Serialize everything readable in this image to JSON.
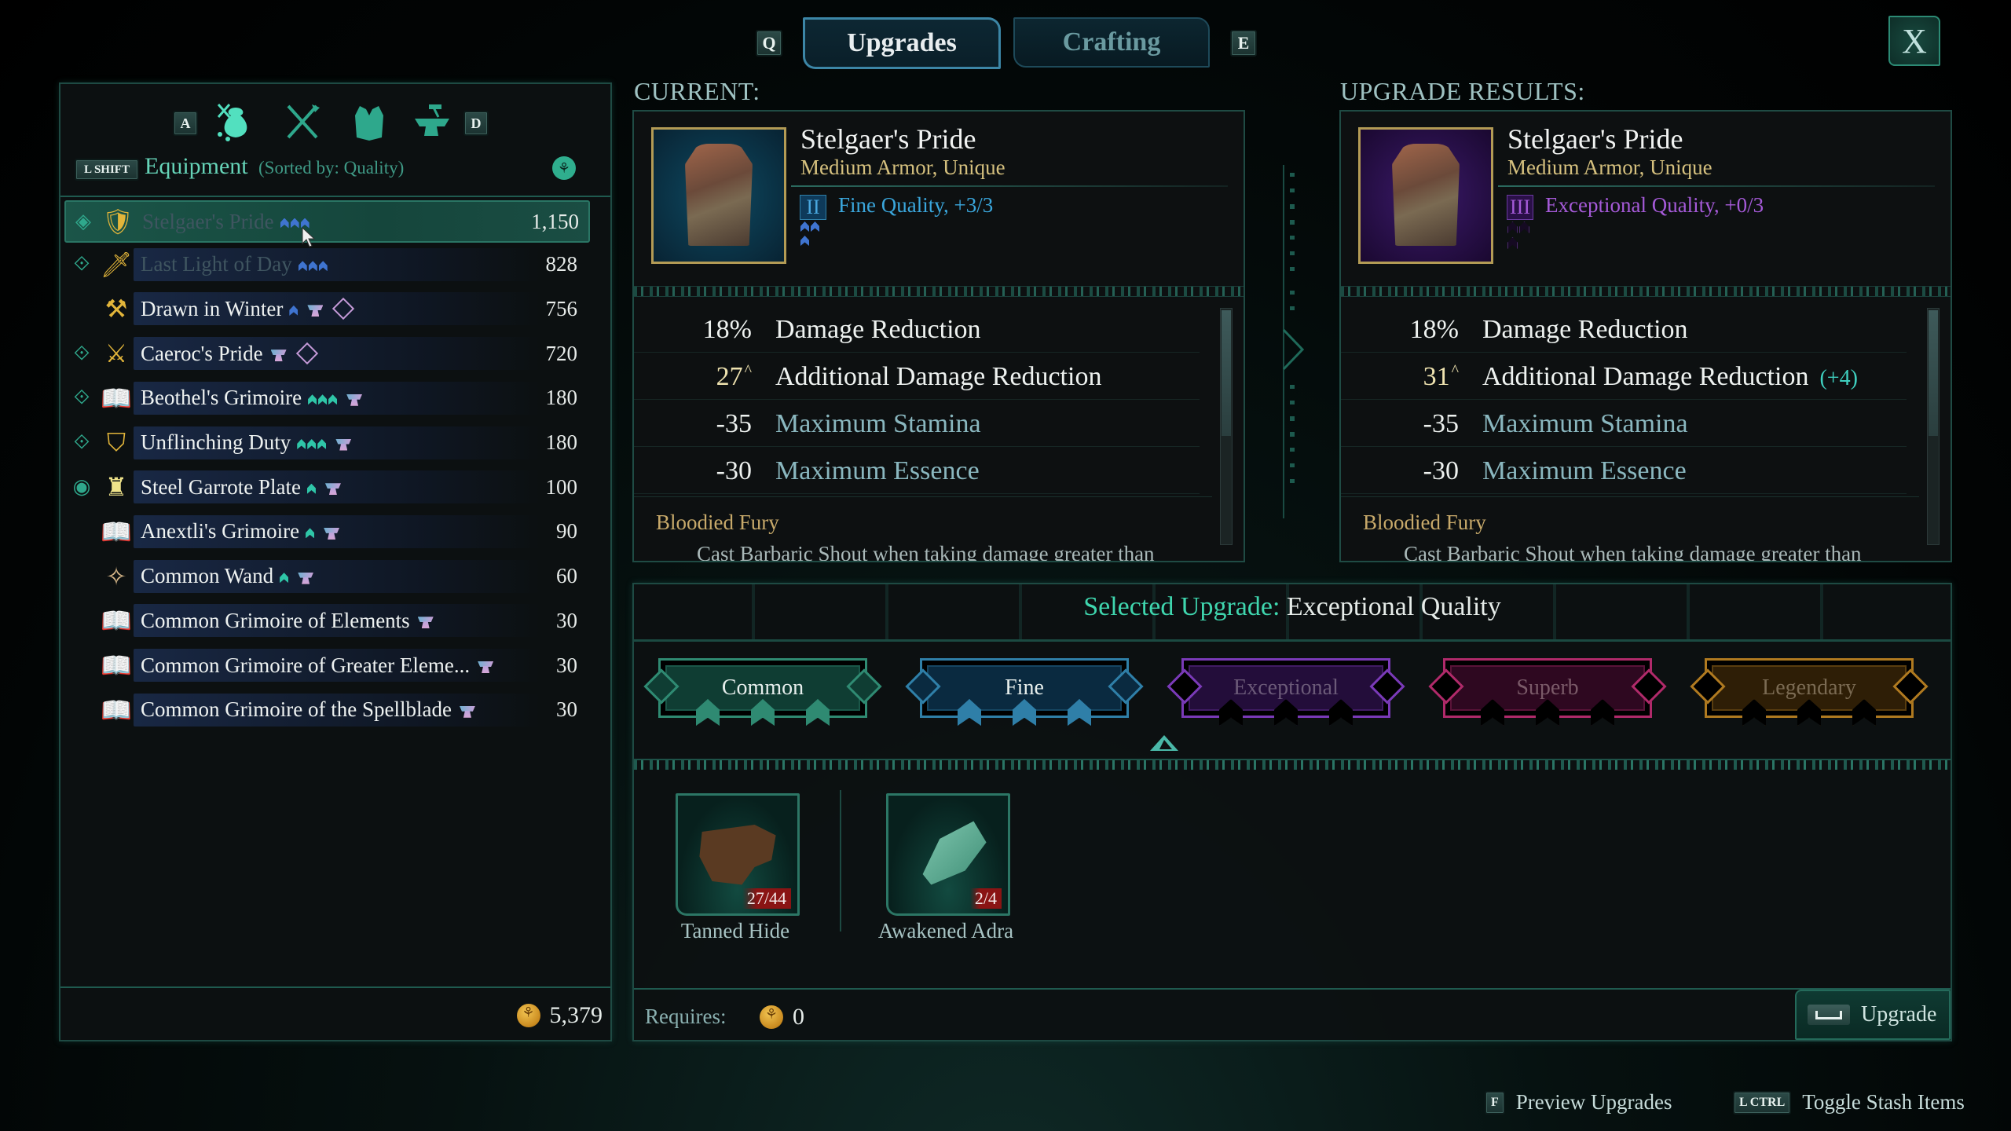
{
  "header": {
    "prev_key": "Q",
    "next_key": "E",
    "tabs": [
      {
        "label": "Upgrades",
        "active": true
      },
      {
        "label": "Crafting",
        "active": false
      }
    ],
    "close_label": "X"
  },
  "inventory": {
    "category_prev_key": "A",
    "category_next_key": "D",
    "categories": [
      {
        "icon": "loot-bag-icon",
        "active": true
      },
      {
        "icon": "crossed-weapons-icon",
        "active": false
      },
      {
        "icon": "armor-icon",
        "active": false
      },
      {
        "icon": "anvil-icon",
        "active": false
      }
    ],
    "sort_key": "L SHIFT",
    "title": "Equipment",
    "sort_text": "(Sorted by: Quality)",
    "items": [
      {
        "name": "Stelgaer's Pride",
        "value": "1,150",
        "lead": "diamond",
        "icon": "armor-icon",
        "icon_color": "#e2b53a",
        "pips": 3,
        "pip_color": "blue",
        "anvil": false,
        "enchant": false,
        "selected": true,
        "dim": true
      },
      {
        "name": "Last Light of Day",
        "value": "828",
        "lead": "double-diamond",
        "icon": "sword-icon",
        "icon_color": "#e2b53a",
        "pips": 3,
        "pip_color": "blue",
        "anvil": false,
        "enchant": false,
        "selected": false,
        "dim": true
      },
      {
        "name": "Drawn in Winter",
        "value": "756",
        "lead": "",
        "icon": "axe-icon",
        "icon_color": "#e2b53a",
        "pips": 1,
        "pip_color": "blue",
        "anvil": true,
        "enchant": true,
        "selected": false,
        "dim": false
      },
      {
        "name": "Caeroc's Pride",
        "value": "720",
        "lead": "double-diamond",
        "icon": "pistol-icon",
        "icon_color": "#e2b53a",
        "pips": 0,
        "pip_color": "",
        "anvil": true,
        "enchant": true,
        "selected": false,
        "dim": false
      },
      {
        "name": "Beothel's Grimoire",
        "value": "180",
        "lead": "double-diamond",
        "icon": "grimoire-icon",
        "icon_color": "#e2c64a",
        "pips": 3,
        "pip_color": "teal",
        "anvil": true,
        "enchant": false,
        "selected": false,
        "dim": false
      },
      {
        "name": "Unflinching Duty",
        "value": "180",
        "lead": "double-diamond",
        "icon": "shield-icon",
        "icon_color": "#e2b53a",
        "pips": 3,
        "pip_color": "teal",
        "anvil": true,
        "enchant": false,
        "selected": false,
        "dim": false
      },
      {
        "name": "Steel Garrote Plate",
        "value": "100",
        "lead": "eye",
        "icon": "plate-armor-icon",
        "icon_color": "#efe38a",
        "pips": 1,
        "pip_color": "teal",
        "anvil": true,
        "enchant": false,
        "selected": false,
        "dim": false
      },
      {
        "name": "Anextli's Grimoire",
        "value": "90",
        "lead": "",
        "icon": "grimoire-icon",
        "icon_color": "#e2c64a",
        "pips": 1,
        "pip_color": "teal",
        "anvil": true,
        "enchant": false,
        "selected": false,
        "dim": false
      },
      {
        "name": "Common Wand",
        "value": "60",
        "lead": "",
        "icon": "wand-icon",
        "icon_color": "#d9b88a",
        "pips": 1,
        "pip_color": "teal",
        "anvil": true,
        "enchant": false,
        "selected": false,
        "dim": false
      },
      {
        "name": "Common Grimoire of Elements",
        "value": "30",
        "lead": "",
        "icon": "grimoire-icon",
        "icon_color": "#b48ad6",
        "pips": 0,
        "pip_color": "",
        "anvil": true,
        "enchant": false,
        "selected": false,
        "dim": false
      },
      {
        "name": "Common Grimoire of Greater Eleme...",
        "value": "30",
        "lead": "",
        "icon": "grimoire-icon",
        "icon_color": "#b48ad6",
        "pips": 0,
        "pip_color": "",
        "anvil": true,
        "enchant": false,
        "selected": false,
        "dim": false
      },
      {
        "name": "Common Grimoire of the Spellblade",
        "value": "30",
        "lead": "",
        "icon": "grimoire-icon",
        "icon_color": "#b48ad6",
        "pips": 0,
        "pip_color": "",
        "anvil": true,
        "enchant": false,
        "selected": false,
        "dim": false
      }
    ],
    "currency": "5,379"
  },
  "current": {
    "label": "CURRENT:",
    "item_name": "Stelgaer's Pride",
    "item_type": "Medium Armor, Unique",
    "quality_numeral": "II",
    "quality_text": "Fine Quality, +3/3",
    "quality_color": "#3aa6dc",
    "stats": [
      {
        "value": "18%",
        "label": "Damage Reduction",
        "style": "white"
      },
      {
        "value": "27",
        "label": "Additional Damage Reduction",
        "style": "gold",
        "caret": "^"
      },
      {
        "value": "-35",
        "label": "Maximum Stamina",
        "style": "blue"
      },
      {
        "value": "-30",
        "label": "Maximum Essence",
        "style": "blue"
      }
    ],
    "perk_name": "Bloodied Fury",
    "perk_desc": "Cast Barbaric Shout when taking damage greater than"
  },
  "result": {
    "label": "UPGRADE RESULTS:",
    "item_name": "Stelgaer's Pride",
    "item_type": "Medium Armor, Unique",
    "quality_numeral": "III",
    "quality_text": "Exceptional Quality, +0/3",
    "quality_color": "#a55ad8",
    "stats": [
      {
        "value": "18%",
        "label": "Damage Reduction",
        "style": "white"
      },
      {
        "value": "31",
        "label": "Additional Damage Reduction",
        "style": "gold",
        "caret": "^",
        "delta": "(+4)"
      },
      {
        "value": "-35",
        "label": "Maximum Stamina",
        "style": "blue"
      },
      {
        "value": "-30",
        "label": "Maximum Essence",
        "style": "blue"
      }
    ],
    "perk_name": "Bloodied Fury",
    "perk_desc": "Cast Barbaric Shout when taking damage greater than"
  },
  "upgrade": {
    "selected_prefix": "Selected Upgrade:",
    "selected_value": "Exceptional Quality",
    "tiers": [
      {
        "label": "Common",
        "color": "#2f8a72",
        "fill": "#0f3d33",
        "text": "#e6eeec",
        "unlocked": true
      },
      {
        "label": "Fine",
        "color": "#2f7fa8",
        "fill": "#0a2a40",
        "text": "#e6eeec",
        "unlocked": true
      },
      {
        "label": "Exceptional",
        "color": "#7a3ab8",
        "fill": "#230d3a",
        "text": "#6b5a78",
        "unlocked": false
      },
      {
        "label": "Superb",
        "color": "#b02a6a",
        "fill": "#2e0820",
        "text": "#7a5a68",
        "unlocked": false
      },
      {
        "label": "Legendary",
        "color": "#b07a20",
        "fill": "#2e1e06",
        "text": "#7a6a52",
        "unlocked": false
      }
    ],
    "materials": [
      {
        "name": "Tanned Hide",
        "count": "27/44",
        "icon": "tanned-hide-icon"
      },
      {
        "name": "Awakened Adra",
        "count": "2/4",
        "icon": "awakened-adra-icon"
      }
    ],
    "requires_label": "Requires:",
    "requires_value": "0",
    "action_label": "Upgrade"
  },
  "footer_hints": [
    {
      "key": "F",
      "label": "Preview Upgrades"
    },
    {
      "key": "L CTRL",
      "label": "Toggle Stash Items"
    }
  ]
}
